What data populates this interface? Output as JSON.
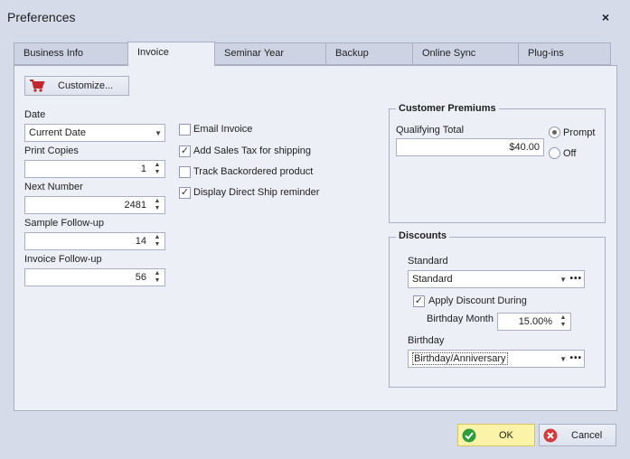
{
  "window": {
    "title": "Preferences",
    "close_glyph": "×"
  },
  "tabs": [
    {
      "label": "Business Info"
    },
    {
      "label": "Invoice"
    },
    {
      "label": "Seminar Year"
    },
    {
      "label": "Backup"
    },
    {
      "label": "Online Sync"
    },
    {
      "label": "Plug-ins"
    }
  ],
  "invoice": {
    "customize_label": "Customize...",
    "date": {
      "label": "Date",
      "value": "Current Date"
    },
    "print_copies": {
      "label": "Print Copies",
      "value": "1"
    },
    "next_number": {
      "label": "Next Number",
      "value": "2481"
    },
    "sample_followup": {
      "label": "Sample Follow-up",
      "value": "14"
    },
    "invoice_followup": {
      "label": "Invoice Follow-up",
      "value": "56"
    },
    "checkboxes": [
      {
        "label": "Email Invoice",
        "checked": false
      },
      {
        "label": "Add Sales Tax for shipping",
        "checked": true
      },
      {
        "label": "Track Backordered product",
        "checked": false
      },
      {
        "label": "Display Direct Ship reminder",
        "checked": true
      }
    ],
    "customer_premiums": {
      "title": "Customer Premiums",
      "qualifying_label": "Qualifying Total",
      "qualifying_value": "$40.00",
      "prompt_label": "Prompt",
      "off_label": "Off",
      "selected": "Prompt"
    },
    "discounts": {
      "title": "Discounts",
      "standard_label": "Standard",
      "standard_value": "Standard",
      "apply_label": "Apply Discount During",
      "apply_checked": true,
      "birthday_month_label": "Birthday Month",
      "birthday_month_value": "15.00%",
      "birthday_label": "Birthday",
      "birthday_value": "Birthday/Anniversary"
    }
  },
  "footer": {
    "ok_label": "OK",
    "cancel_label": "Cancel"
  },
  "colors": {
    "accent_ok": "#2e9d3c",
    "cancel_red": "#d23b3b",
    "cart_red": "#c0282c",
    "ok_bg": "#fbf3a7"
  },
  "icons": {
    "cart": "cart-icon",
    "ok": "check-circle-icon",
    "cancel": "cancel-circle-icon",
    "checkmark": "✓",
    "arrow_up": "▲",
    "arrow_down": "▼",
    "ellipsis": "•••"
  }
}
